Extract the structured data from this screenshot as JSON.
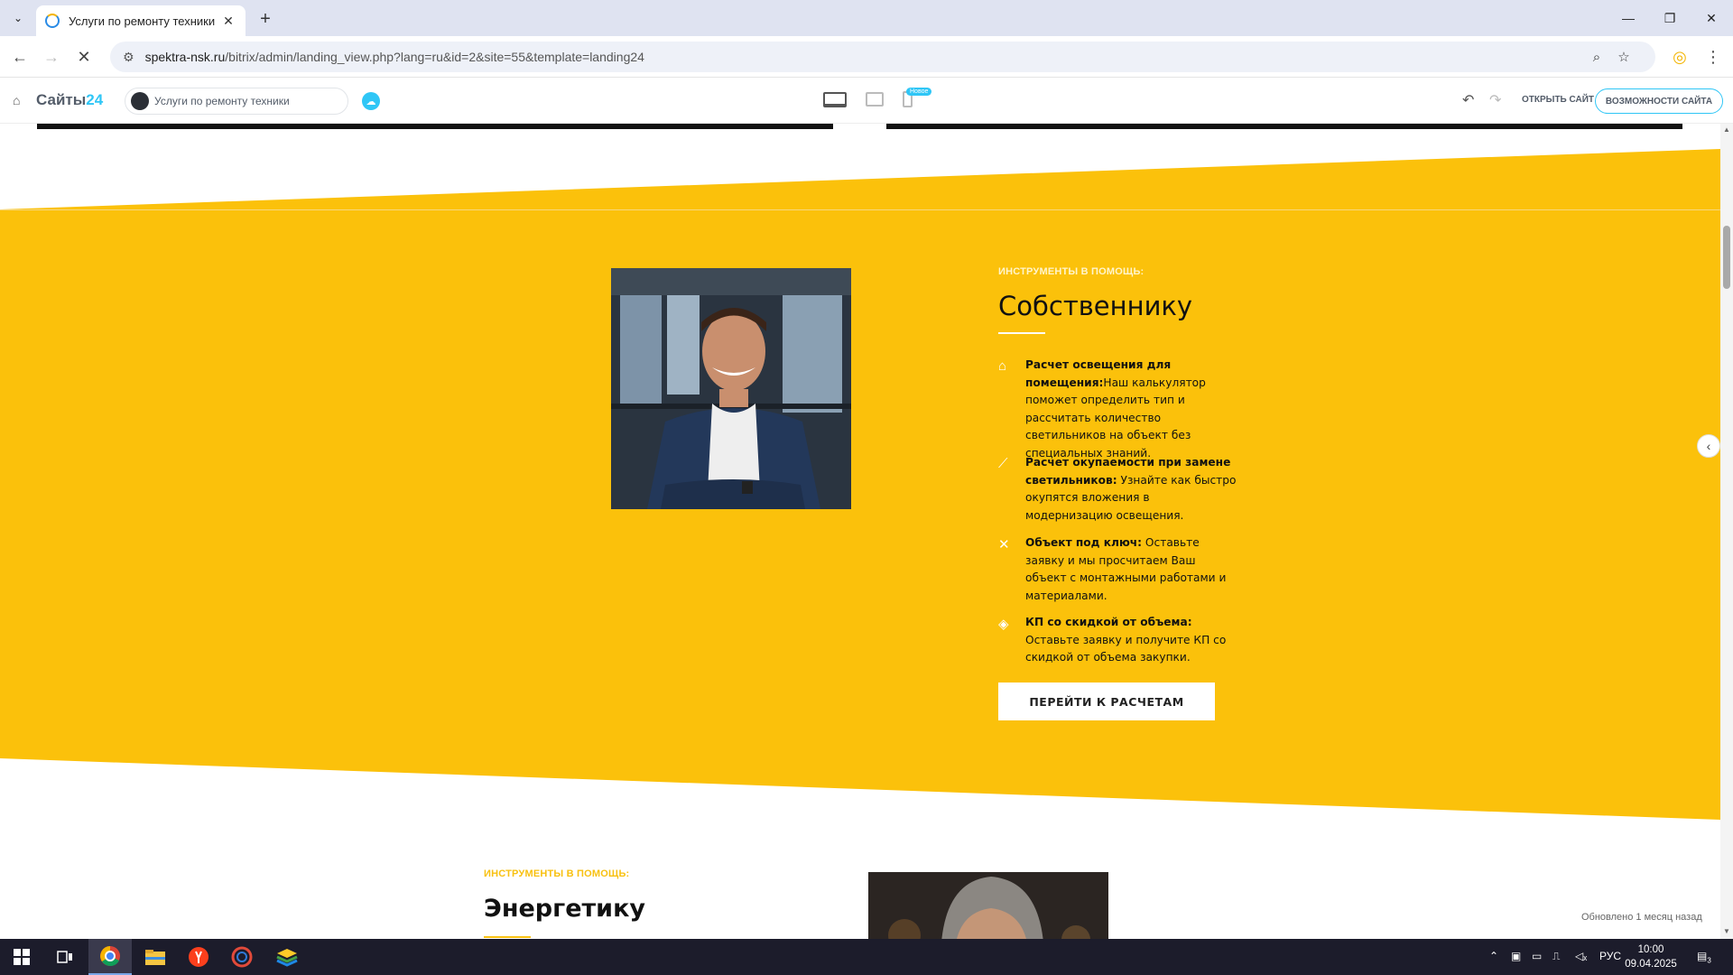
{
  "browser": {
    "tab_title": "Услуги по ремонту техники",
    "url_host": "spektra-nsk.ru",
    "url_path": "/bitrix/admin/landing_view.php?lang=ru&id=2&site=55&template=landing24"
  },
  "editor": {
    "logo_text": "Сайты",
    "logo_num": "24",
    "site_name": "Услуги по ремонту техники",
    "new_badge": "Новое",
    "open_site": "ОТКРЫТЬ САЙТ",
    "features": "ВОЗМОЖНОСТИ САЙТА"
  },
  "owner_section": {
    "eyebrow": "ИНСТРУМЕНТЫ В ПОМОЩЬ:",
    "title": "Собственнику",
    "items": [
      {
        "icon": "home-light-icon",
        "bold": "Расчет освещения для помещения:",
        "text": "Наш калькулятор поможет определить тип и рассчитать количество светильников на объект без специальных знаний."
      },
      {
        "icon": "chart-line-icon",
        "bold": "Расчет окупаемости при замене светильников:",
        "text": " Узнайте как быстро окупятся вложения в модернизацию освещения."
      },
      {
        "icon": "tools-icon",
        "bold": "Объект под ключ:",
        "text": " Оставьте заявку и мы просчитаем Ваш объект с монтажными работами и материалами."
      },
      {
        "icon": "discount-tag-icon",
        "bold": "КП со скидкой от объема:",
        "text": " Оставьте заявку и получите КП со скидкой от объема закупки."
      }
    ],
    "cta": "ПЕРЕЙТИ К РАСЧЕТАМ"
  },
  "energy_section": {
    "eyebrow": "ИНСТРУМЕНТЫ В ПОМОЩЬ:",
    "title": "Энергетику"
  },
  "updated_text": "Обновлено 1 месяц назад",
  "taskbar": {
    "lang": "РУС",
    "time": "10:00",
    "date": "09.04.2025",
    "notif_count": "3"
  },
  "colors": {
    "yellow": "#fbc10b",
    "accent": "#2fc6f6"
  }
}
